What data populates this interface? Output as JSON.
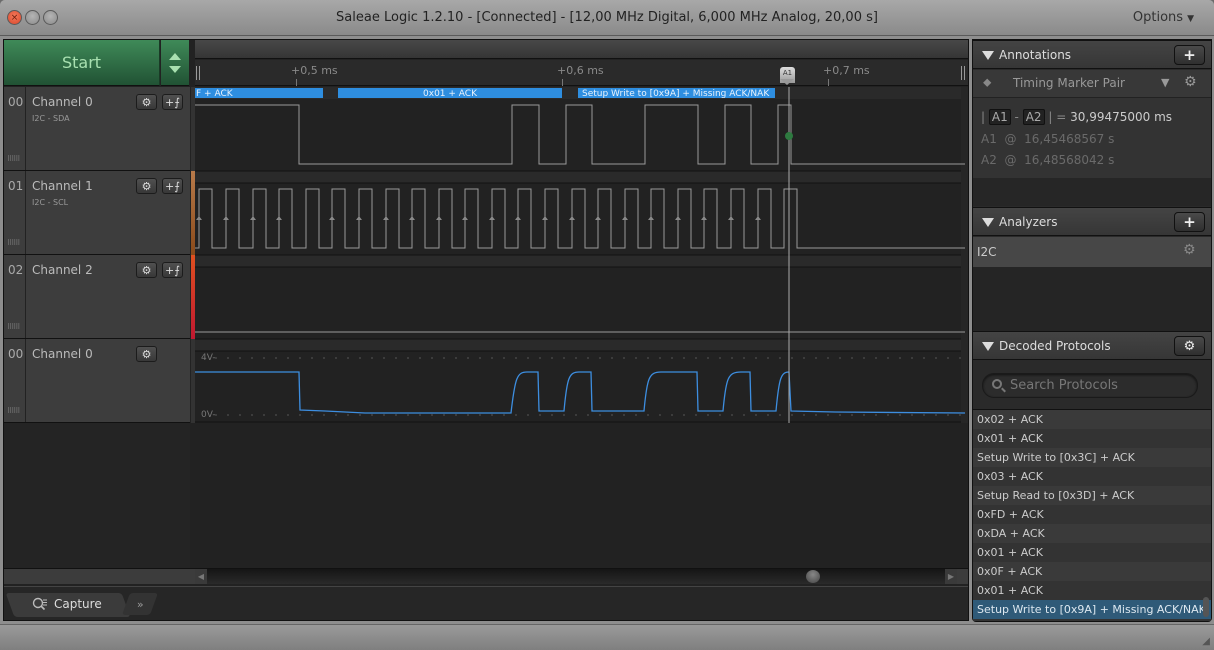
{
  "window": {
    "title": "Saleae Logic 1.2.10 - [Connected] - [12,00 MHz Digital, 6,000 MHz Analog, 20,00 s]",
    "options_label": "Options",
    "close_glyph": "×"
  },
  "toolbar": {
    "start_label": "Start"
  },
  "ruler": {
    "ticks": [
      "+0,5 ms",
      "+0,6 ms",
      "+0,7 ms"
    ],
    "marker_label": "A1"
  },
  "channels": [
    {
      "num": "00",
      "name": "Channel 0",
      "sub": "I2C - SDA",
      "color": "#3a3a3a",
      "has_trigger": true
    },
    {
      "num": "01",
      "name": "Channel 1",
      "sub": "I2C - SCL",
      "color": "#a0602a",
      "has_trigger": true
    },
    {
      "num": "02",
      "name": "Channel 2",
      "sub": "",
      "color": "#d03030",
      "has_trigger": true
    },
    {
      "num": "00",
      "name": "Channel 0",
      "sub": "",
      "color": "#3a3a3a",
      "has_trigger": false
    }
  ],
  "decoded_bubbles": [
    {
      "label": "F + ACK"
    },
    {
      "label": "0x01 + ACK"
    },
    {
      "label": "Setup Write to [0x9A] + Missing ACK/NAK"
    }
  ],
  "analog": {
    "top_label": "4V-",
    "bottom_label": "0V-",
    "trace_color": "#3d8ee0"
  },
  "icons": {
    "gear": "⚙",
    "trigger": "+⨍",
    "plus": "+",
    "dots": "⠿⠿⠿",
    "left": "◀",
    "right": "▶",
    "more": "»"
  },
  "tabs": {
    "capture_label": "Capture"
  },
  "annotations": {
    "title": "Annotations",
    "type_label": "Timing Marker Pair",
    "delta_prefix": "|",
    "a1": "A1",
    "dash": "-",
    "a2": "A2",
    "delta_suffix": "| =",
    "delta_value": "30,99475000 ms",
    "a1_at_label": "A1",
    "a1_at": "@",
    "a1_time": "16,45468567 s",
    "a2_at_label": "A2",
    "a2_at": "@",
    "a2_time": "16,48568042 s"
  },
  "analyzers": {
    "title": "Analyzers",
    "items": [
      {
        "label": "I2C"
      }
    ]
  },
  "decoded_protocols": {
    "title": "Decoded Protocols",
    "search_placeholder": "Search Protocols",
    "items": [
      "0x02 + ACK",
      "0x01 + ACK",
      "Setup Write to [0x3C] + ACK",
      "0x03 + ACK",
      "Setup Read to [0x3D] + ACK",
      "0xFD + ACK",
      "0xDA + ACK",
      "0x01 + ACK",
      "0x0F + ACK",
      "0x01 + ACK",
      "Setup Write to [0x9A] + Missing ACK/NAK"
    ],
    "selected_index": 10
  }
}
